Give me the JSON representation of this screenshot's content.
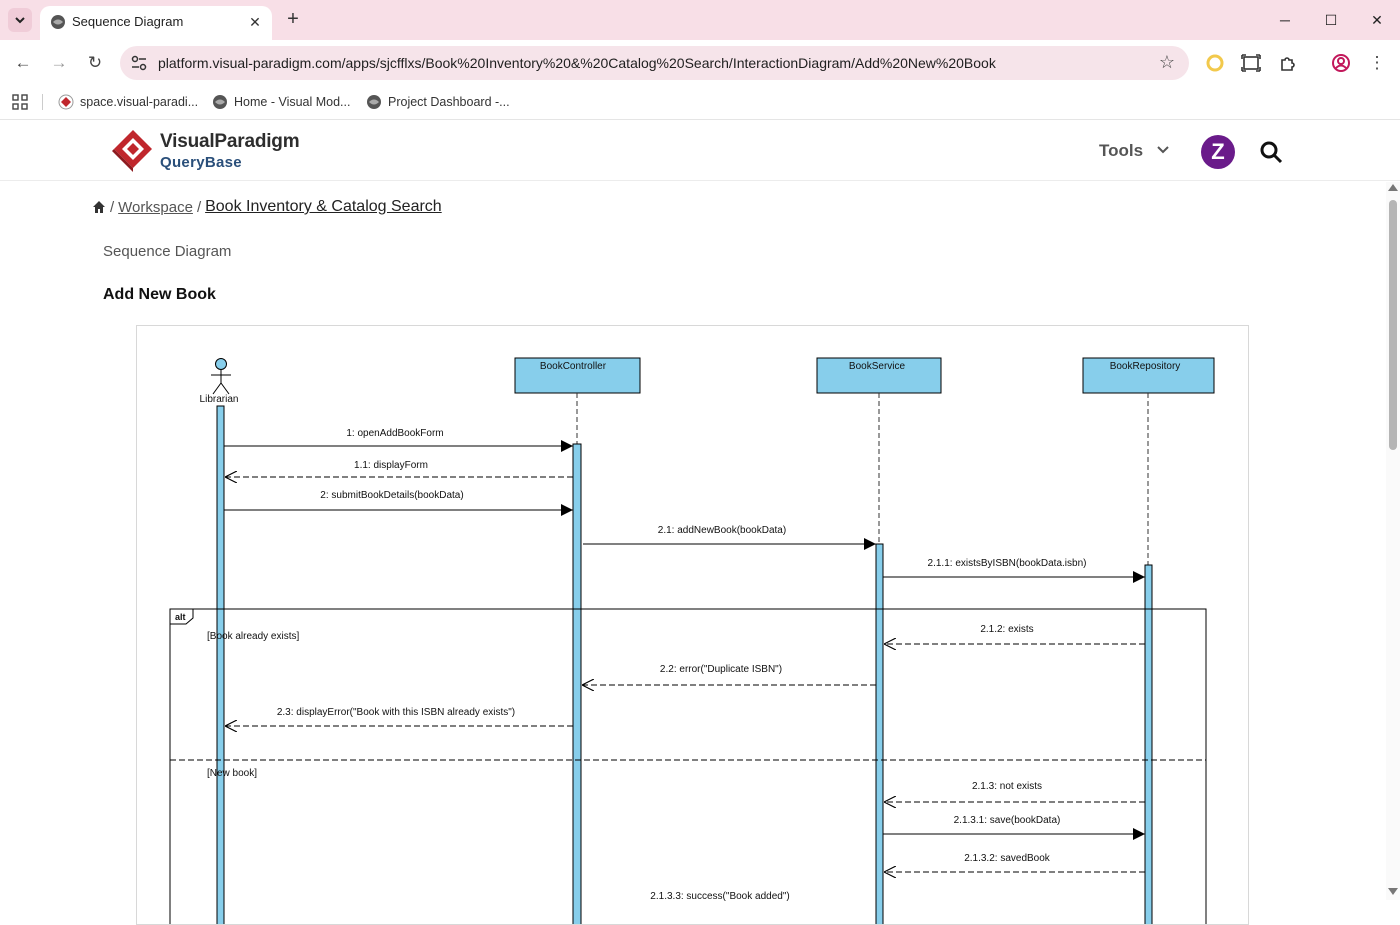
{
  "browser": {
    "tab_title": "Sequence Diagram",
    "url": "platform.visual-paradigm.com/apps/sjcfflxs/Book%20Inventory%20&%20Catalog%20Search/InteractionDiagram/Add%20New%20Book",
    "bookmarks": [
      {
        "label": "space.visual-paradi..."
      },
      {
        "label": "Home - Visual Mod..."
      },
      {
        "label": "Project Dashboard -..."
      }
    ]
  },
  "header": {
    "logo_title": "VisualParadigm",
    "logo_subtitle": "QueryBase",
    "tools_label": "Tools",
    "avatar_letter": "Z",
    "brand_color": "#c0272d",
    "avatar_color": "#6a1b8a"
  },
  "breadcrumb": {
    "home_icon": "home-icon",
    "workspace": "Workspace",
    "current": "Book Inventory & Catalog Search"
  },
  "page": {
    "doc_type": "Sequence Diagram",
    "doc_title": "Add New Book"
  },
  "diagram": {
    "actor": "Librarian",
    "lifelines": [
      "BookController",
      "BookService",
      "BookRepository"
    ],
    "fragment": {
      "operator": "alt",
      "guard1": "[Book already exists]",
      "guard2": "[New book]"
    },
    "messages": [
      {
        "label": "1: openAddBookForm",
        "kind": "sync"
      },
      {
        "label": "1.1: displayForm",
        "kind": "return"
      },
      {
        "label": "2: submitBookDetails(bookData)",
        "kind": "sync"
      },
      {
        "label": "2.1: addNewBook(bookData)",
        "kind": "sync"
      },
      {
        "label": "2.1.1: existsByISBN(bookData.isbn)",
        "kind": "sync"
      },
      {
        "label": "2.1.2: exists",
        "kind": "return"
      },
      {
        "label": "2.2: error(\"Duplicate ISBN\")",
        "kind": "return"
      },
      {
        "label": "2.3: displayError(\"Book with this ISBN already exists\")",
        "kind": "return"
      },
      {
        "label": "2.1.3: not exists",
        "kind": "return"
      },
      {
        "label": "2.1.3.1: save(bookData)",
        "kind": "sync"
      },
      {
        "label": "2.1.3.2: savedBook",
        "kind": "return"
      },
      {
        "label": "2.1.3.3: success(\"Book added\")",
        "kind": "return"
      }
    ],
    "colors": {
      "lifeline_fill": "#87ceeb"
    }
  }
}
